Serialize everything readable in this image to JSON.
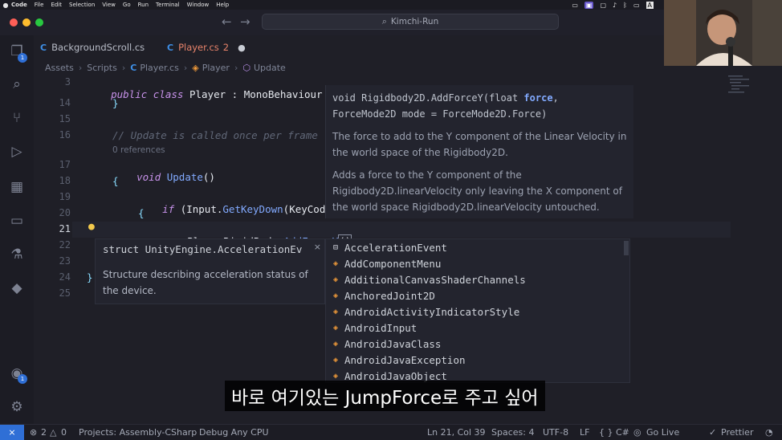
{
  "menubar": {
    "items": [
      "Code",
      "File",
      "Edit",
      "Selection",
      "View",
      "Go",
      "Run",
      "Terminal",
      "Window",
      "Help"
    ]
  },
  "command_center": {
    "text": "Kimchi-Run"
  },
  "tabs": [
    {
      "label": "BackgroundScroll.cs"
    },
    {
      "label": "Player.cs",
      "badge": "2"
    }
  ],
  "breadcrumb": [
    "Assets",
    "Scripts",
    "Player.cs",
    "Player",
    "Update"
  ],
  "activity_badges": {
    "explorer": "1",
    "accounts": "1"
  },
  "code": {
    "line_numbers": [
      "3",
      "14",
      "15",
      "16",
      "17",
      "18",
      "19",
      "20",
      "21",
      "22",
      "23",
      "24",
      "25"
    ],
    "line3": {
      "kw1": "public",
      "kw2": "class",
      "name": "Player",
      "sep": ":",
      "base": "MonoBehaviour"
    },
    "line14": "}",
    "line16_comment": "// Update is called once per frame",
    "references": "0 references",
    "line17": {
      "kw": "void",
      "fn": "Update",
      "paren": "()"
    },
    "line18": "{",
    "line19": {
      "kw": "if",
      "open": "(",
      "obj": "Input",
      "dot": ".",
      "fn": "GetKeyDown",
      "arg": "(KeyCode.S"
    },
    "line20": "{",
    "line21": {
      "obj": "PlayerRigidBody",
      "dot": ".",
      "fn": "AddForceY",
      "paren": "()"
    },
    "line24": "}"
  },
  "hover": {
    "sig_prefix": "void Rigidbody2D.AddForceY(float",
    "sig_param": "force",
    "sig_suffix": ",",
    "sig_line2": "ForceMode2D mode = ForceMode2D.Force)",
    "para1": "The force to add to the Y component of the Linear Velocity in the world space of the Rigidbody2D.",
    "para2": "Adds a force to the Y component of the Rigidbody2D.linearVelocity only leaving the X component of the world space Rigidbody2D.linearVelocity untouched."
  },
  "suggest_detail": {
    "type": "struct UnityEngine.AccelerationEv",
    "close": "×",
    "description": "Structure describing acceleration status of the device."
  },
  "suggestions": [
    {
      "label": "AccelerationEvent",
      "icon": "struct-icon"
    },
    {
      "label": "AddComponentMenu",
      "icon": "class-icon"
    },
    {
      "label": "AdditionalCanvasShaderChannels",
      "icon": "class-icon"
    },
    {
      "label": "AnchoredJoint2D",
      "icon": "class-icon"
    },
    {
      "label": "AndroidActivityIndicatorStyle",
      "icon": "class-icon"
    },
    {
      "label": "AndroidInput",
      "icon": "class-icon"
    },
    {
      "label": "AndroidJavaClass",
      "icon": "class-icon"
    },
    {
      "label": "AndroidJavaException",
      "icon": "class-icon"
    },
    {
      "label": "AndroidJavaObject",
      "icon": "class-icon"
    }
  ],
  "subtitle": "바로 여기있는 JumpForce로 주고 싶어",
  "statusbar": {
    "errors": "2",
    "warnings": "0",
    "project": "Projects: Assembly-CSharp",
    "debug": "Debug Any CPU",
    "position": "Ln 21, Col 39",
    "spaces": "Spaces: 4",
    "encoding": "UTF-8",
    "eol": "LF",
    "language": "{ } C#",
    "golive": "Go Live",
    "prettier": "Prettier"
  },
  "colors": {
    "accent": "#2f6fd6",
    "modified_tab": "#e8836a",
    "class_icon": "#ef9a3a"
  }
}
